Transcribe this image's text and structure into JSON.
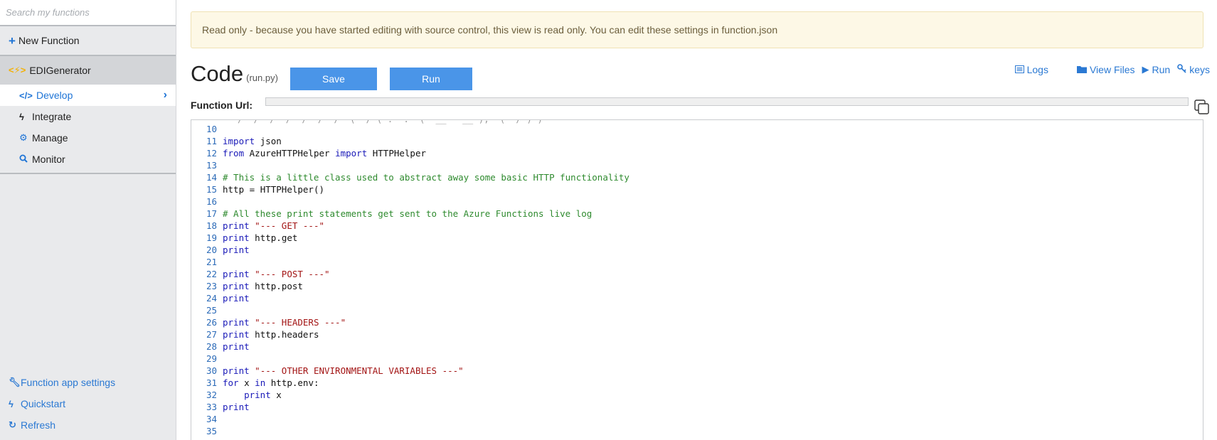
{
  "sidebar": {
    "search_placeholder": "Search my functions",
    "new_function": "New Function",
    "function_name": "EDIGenerator",
    "items": [
      {
        "label": "Develop",
        "icon": "code-icon",
        "active": true
      },
      {
        "label": "Integrate",
        "icon": "bolt-icon"
      },
      {
        "label": "Manage",
        "icon": "gear-icon"
      },
      {
        "label": "Monitor",
        "icon": "search-icon"
      }
    ],
    "bottom_links": [
      {
        "label": "Function app settings",
        "icon": "wrench-icon"
      },
      {
        "label": "Quickstart",
        "icon": "bolt-icon"
      },
      {
        "label": "Refresh",
        "icon": "refresh-icon"
      }
    ]
  },
  "banner": {
    "text": "Read only - because you have started editing with source control, this view is read only. You can edit these settings in function.json"
  },
  "header": {
    "title": "Code",
    "file": "(run.py)",
    "save_label": "Save",
    "run_label": "Run",
    "links": {
      "logs": "Logs",
      "view_files": "View Files",
      "run": "Run",
      "keys": "keys"
    },
    "function_url_label": "Function Url:",
    "function_url_value": ""
  },
  "editor": {
    "lines": [
      {
        "n": "10",
        "text": ""
      },
      {
        "n": "11",
        "text": "import json"
      },
      {
        "n": "12",
        "text": "from AzureHTTPHelper import HTTPHelper"
      },
      {
        "n": "13",
        "text": ""
      },
      {
        "n": "14",
        "text": "# This is a little class used to abstract away some basic HTTP functionality"
      },
      {
        "n": "15",
        "text": "http = HTTPHelper()"
      },
      {
        "n": "16",
        "text": ""
      },
      {
        "n": "17",
        "text": "# All these print statements get sent to the Azure Functions live log"
      },
      {
        "n": "18",
        "text": "print \"--- GET ---\""
      },
      {
        "n": "19",
        "text": "print http.get"
      },
      {
        "n": "20",
        "text": "print"
      },
      {
        "n": "21",
        "text": ""
      },
      {
        "n": "22",
        "text": "print \"--- POST ---\""
      },
      {
        "n": "23",
        "text": "print http.post"
      },
      {
        "n": "24",
        "text": "print"
      },
      {
        "n": "25",
        "text": ""
      },
      {
        "n": "26",
        "text": "print \"--- HEADERS ---\""
      },
      {
        "n": "27",
        "text": "print http.headers"
      },
      {
        "n": "28",
        "text": "print"
      },
      {
        "n": "29",
        "text": ""
      },
      {
        "n": "30",
        "text": "print \"--- OTHER ENVIRONMENTAL VARIABLES ---\""
      },
      {
        "n": "31",
        "text": "for x in http.env:"
      },
      {
        "n": "32",
        "text": "    print x"
      },
      {
        "n": "33",
        "text": "print"
      },
      {
        "n": "34",
        "text": ""
      },
      {
        "n": "35",
        "text": ""
      }
    ]
  }
}
